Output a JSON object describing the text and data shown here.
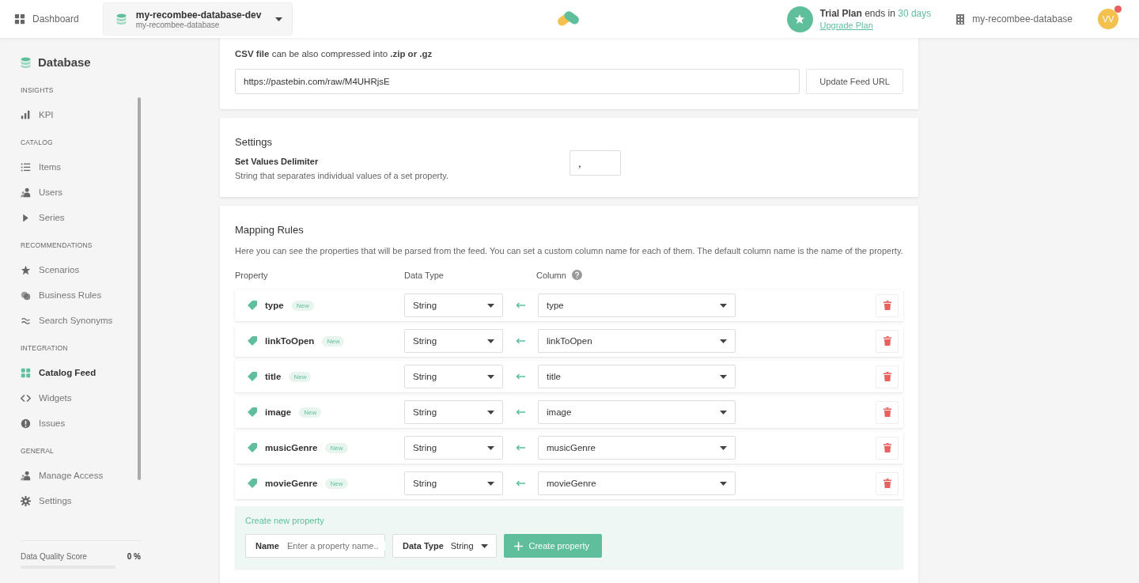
{
  "header": {
    "dashboard_link": "Dashboard",
    "database_selector": {
      "title": "my-recombee-database-dev",
      "subtitle": "my-recombee-database"
    },
    "trial": {
      "text": "**Trial Plan** ends in",
      "days": "30 days",
      "link": "Upgrade Plan"
    },
    "database_name": "my-recombee-database",
    "avatar": {
      "initials": "VV",
      "has_notification": true
    }
  },
  "sidebar": {
    "title": "Database",
    "sections": [
      {
        "heading": "INSIGHTS",
        "items": [
          {
            "label": "KPI",
            "selected": false
          }
        ]
      },
      {
        "heading": "CATALOG",
        "items": [
          {
            "label": "Items",
            "selected": false
          },
          {
            "label": "Users",
            "selected": false
          },
          {
            "label": "Series",
            "selected": false
          }
        ]
      },
      {
        "heading": "RECOMMENDATIONS",
        "items": [
          {
            "label": "Scenarios",
            "selected": false
          },
          {
            "label": "Business Rules",
            "selected": false
          },
          {
            "label": "Search Synonyms",
            "selected": false
          }
        ]
      },
      {
        "heading": "INTEGRATION",
        "items": [
          {
            "label": "Catalog Feed",
            "selected": true
          },
          {
            "label": "Widgets",
            "selected": false
          },
          {
            "label": "Issues",
            "selected": false
          }
        ]
      },
      {
        "heading": "GENERAL",
        "items": [
          {
            "label": "Manage Access",
            "selected": false
          },
          {
            "label": "Settings",
            "selected": false
          }
        ]
      }
    ],
    "quality": {
      "label": "Data Quality Score",
      "value": "0 %",
      "level": 0
    }
  },
  "feed_card": {
    "note": "**CSV file** can be also compressed into **.zip or .gz**",
    "url": "https://pastebin.com/raw/M4UHRjsE",
    "button": "Update Feed URL"
  },
  "settings_card": {
    "title": "Settings",
    "label": "Set Values Delimiter",
    "description": "String that separates individual values of a set property.",
    "value": ","
  },
  "mapping_card": {
    "title": "Mapping Rules",
    "description": "Here you can see the properties that will be parsed from the feed. You can set a custom column name for each of them. The default column name is the name of the property.",
    "columns": [
      "Property",
      "Data Type",
      "Column"
    ],
    "rows": [
      {
        "name": "type",
        "badge": "New",
        "data_type": "String",
        "column": "type"
      },
      {
        "name": "linkToOpen",
        "badge": "New",
        "data_type": "String",
        "column": "linkToOpen"
      },
      {
        "name": "title",
        "badge": "New",
        "data_type": "String",
        "column": "title"
      },
      {
        "name": "image",
        "badge": "New",
        "data_type": "String",
        "column": "image"
      },
      {
        "name": "musicGenre",
        "badge": "New",
        "data_type": "String",
        "column": "musicGenre"
      },
      {
        "name": "movieGenre",
        "badge": "New",
        "data_type": "String",
        "column": "movieGenre"
      }
    ],
    "create": {
      "heading": "Create new property",
      "name_label": "Name",
      "name_placeholder": "Enter a property name..",
      "type_label": "Data Type",
      "type_value": "String",
      "button": "Create property"
    }
  }
}
